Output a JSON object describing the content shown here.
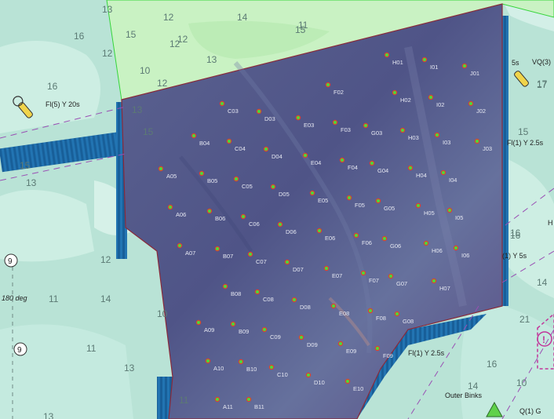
{
  "map": {
    "colors": {
      "sea": "#b9e3d6",
      "sea_light": "#d3efe7",
      "zone": "#c9f2c3",
      "zone_border": "#35d53a",
      "survey": "#5d5f8f",
      "survey_edge": "#8a2a3a",
      "bathy": "#1d6fae",
      "marker": "#4cd93b",
      "marker_ring": "#e0412b",
      "lane": "#9a4fb4",
      "depth_text": "#5c7a74",
      "magenta": "#c2349a"
    },
    "depths": [
      "13",
      "12",
      "14",
      "15",
      "16",
      "15",
      "12",
      "12",
      "13",
      "16",
      "12",
      "10",
      "15",
      "15",
      "13",
      "13",
      "11",
      "12",
      "13",
      "11",
      "14",
      "12",
      "10",
      "11",
      "13",
      "11",
      "17",
      "15",
      "16",
      "14",
      "16",
      "21",
      "16",
      "14",
      "10",
      "17"
    ],
    "lights": {
      "fl5": "Fl(5) Y 20s",
      "vq3": "VQ(3)",
      "fl1_east": "Fl(1) Y 2.5s",
      "fl1_5s": "(1) Y 5s",
      "fl1_south": "Fl(1) Y 2.5s",
      "q1": "Q(1) G",
      "s5": "5s",
      "h": "H"
    },
    "place_names": {
      "outer_binks": "Outer Binks"
    },
    "bearing": "180 deg",
    "notes": {
      "n9": "9",
      "n9b": "9"
    },
    "grid": {
      "points": [
        "H01",
        "I01",
        "J01",
        "F02",
        "H02",
        "I02",
        "J02",
        "C03",
        "D03",
        "E03",
        "F03",
        "G03",
        "H03",
        "I03",
        "J03",
        "B04",
        "C04",
        "D04",
        "E04",
        "F04",
        "G04",
        "H04",
        "I04",
        "A05",
        "B05",
        "C05",
        "D05",
        "E05",
        "F05",
        "G05",
        "H05",
        "I05",
        "A06",
        "B06",
        "C06",
        "D06",
        "E06",
        "F06",
        "G06",
        "H06",
        "I06",
        "A07",
        "B07",
        "C07",
        "D07",
        "E07",
        "F07",
        "G07",
        "H07",
        "B08",
        "C08",
        "D08",
        "E08",
        "F08",
        "G08",
        "A09",
        "B09",
        "C09",
        "D09",
        "E09",
        "F09",
        "A10",
        "B10",
        "C10",
        "D10",
        "E10",
        "A11",
        "B11"
      ]
    }
  }
}
